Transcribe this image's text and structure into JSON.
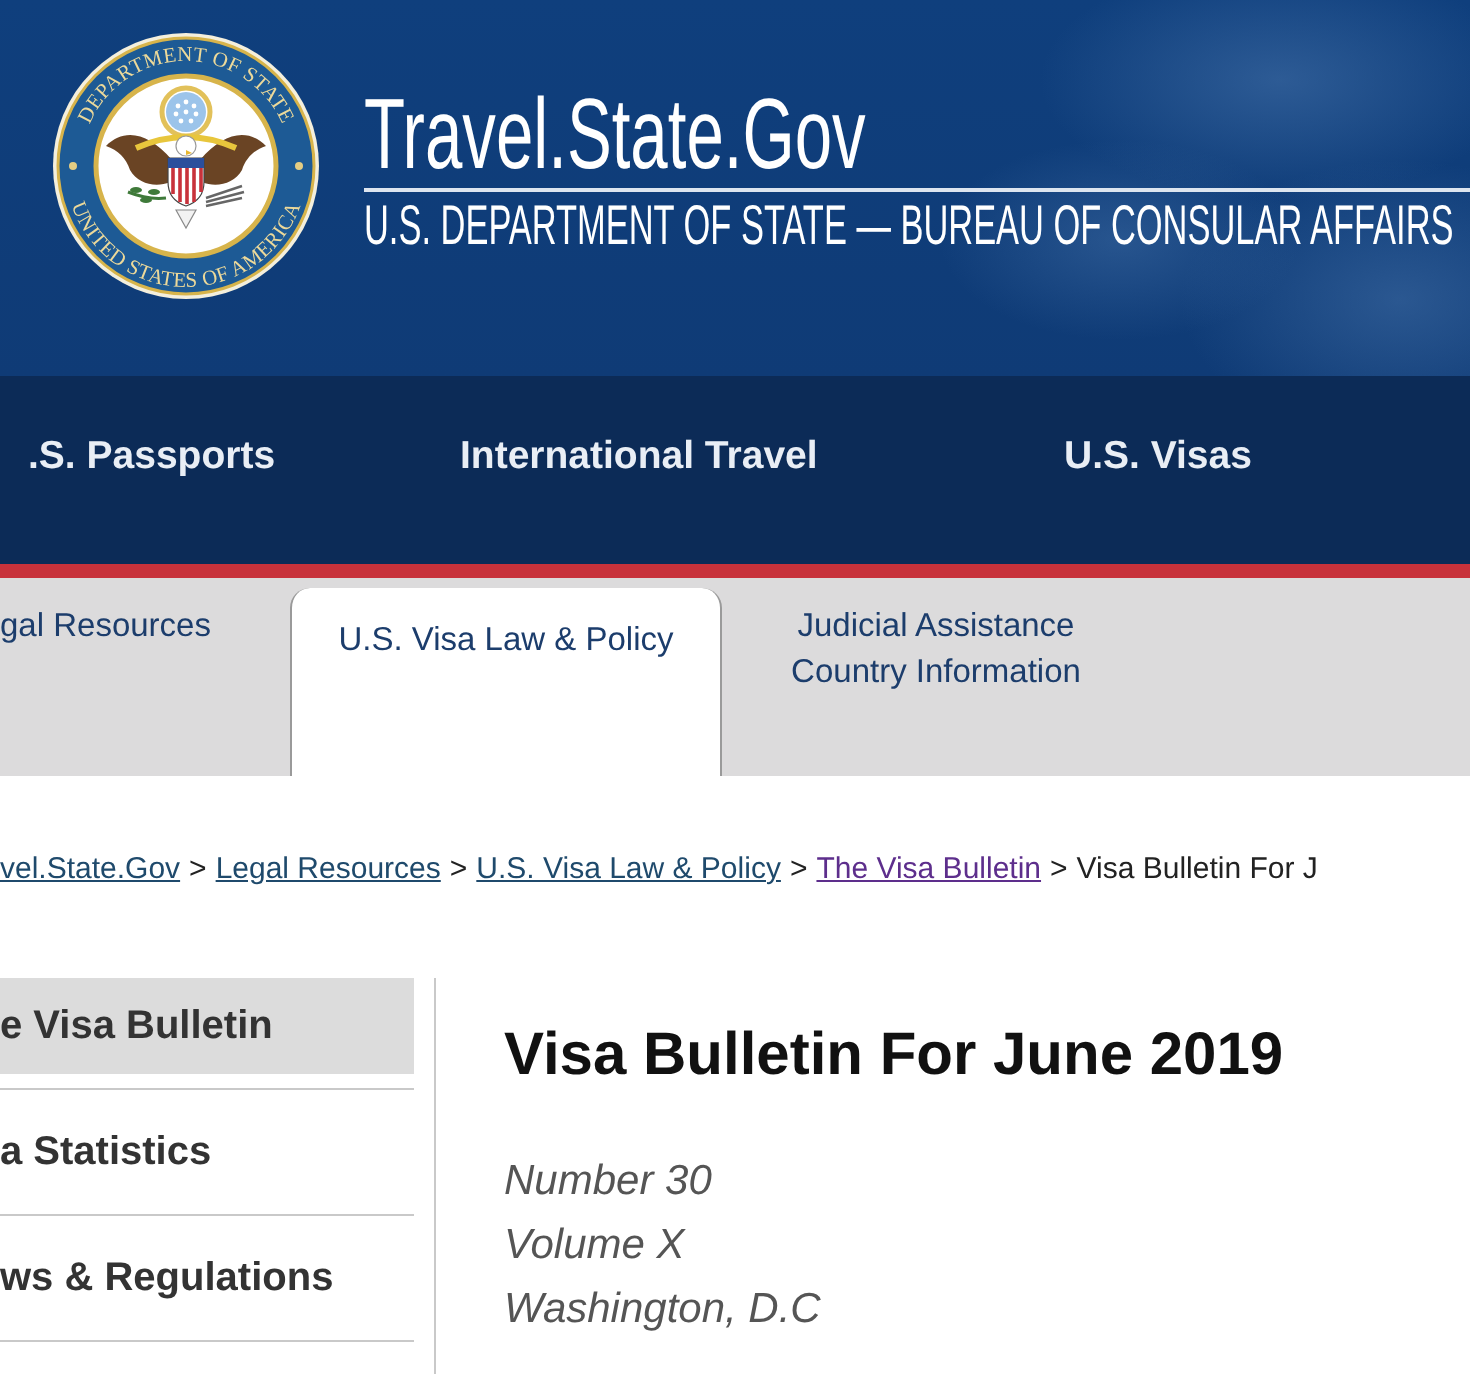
{
  "header": {
    "seal": {
      "top_text": "DEPARTMENT OF STATE",
      "bottom_text": "UNITED STATES OF AMERICA"
    },
    "title": "Travel.State.Gov",
    "subtitle": "U.S. DEPARTMENT OF STATE — BUREAU OF CONSULAR AFFAIRS"
  },
  "main_nav": [
    {
      "label": ".S. Passports"
    },
    {
      "label": "International Travel"
    },
    {
      "label": "U.S. Visas"
    }
  ],
  "sub_nav": [
    {
      "label": "gal Resources",
      "selected": false
    },
    {
      "label": "U.S. Visa Law & Policy",
      "selected": true
    },
    {
      "label": "Judicial Assistance Country Information",
      "selected": false
    }
  ],
  "breadcrumb": [
    {
      "kind": "link",
      "label": "vel.State.Gov",
      "visited": false
    },
    {
      "kind": "separator",
      "label": ">"
    },
    {
      "kind": "link",
      "label": "Legal Resources",
      "visited": false
    },
    {
      "kind": "separator",
      "label": ">"
    },
    {
      "kind": "link",
      "label": "U.S. Visa Law & Policy",
      "visited": false
    },
    {
      "kind": "separator",
      "label": ">"
    },
    {
      "kind": "link",
      "label": "The Visa Bulletin",
      "visited": true
    },
    {
      "kind": "separator",
      "label": ">"
    },
    {
      "kind": "current",
      "label": "Visa Bulletin For J"
    }
  ],
  "sidebar": [
    {
      "label": "e Visa Bulletin",
      "selected": true
    },
    {
      "label": "a Statistics",
      "selected": false
    },
    {
      "label": "ws & Regulations",
      "selected": false
    }
  ],
  "article": {
    "title": "Visa Bulletin For June 2019",
    "meta_lines": [
      "Number 30",
      "Volume X",
      "Washington, D.C"
    ]
  }
}
